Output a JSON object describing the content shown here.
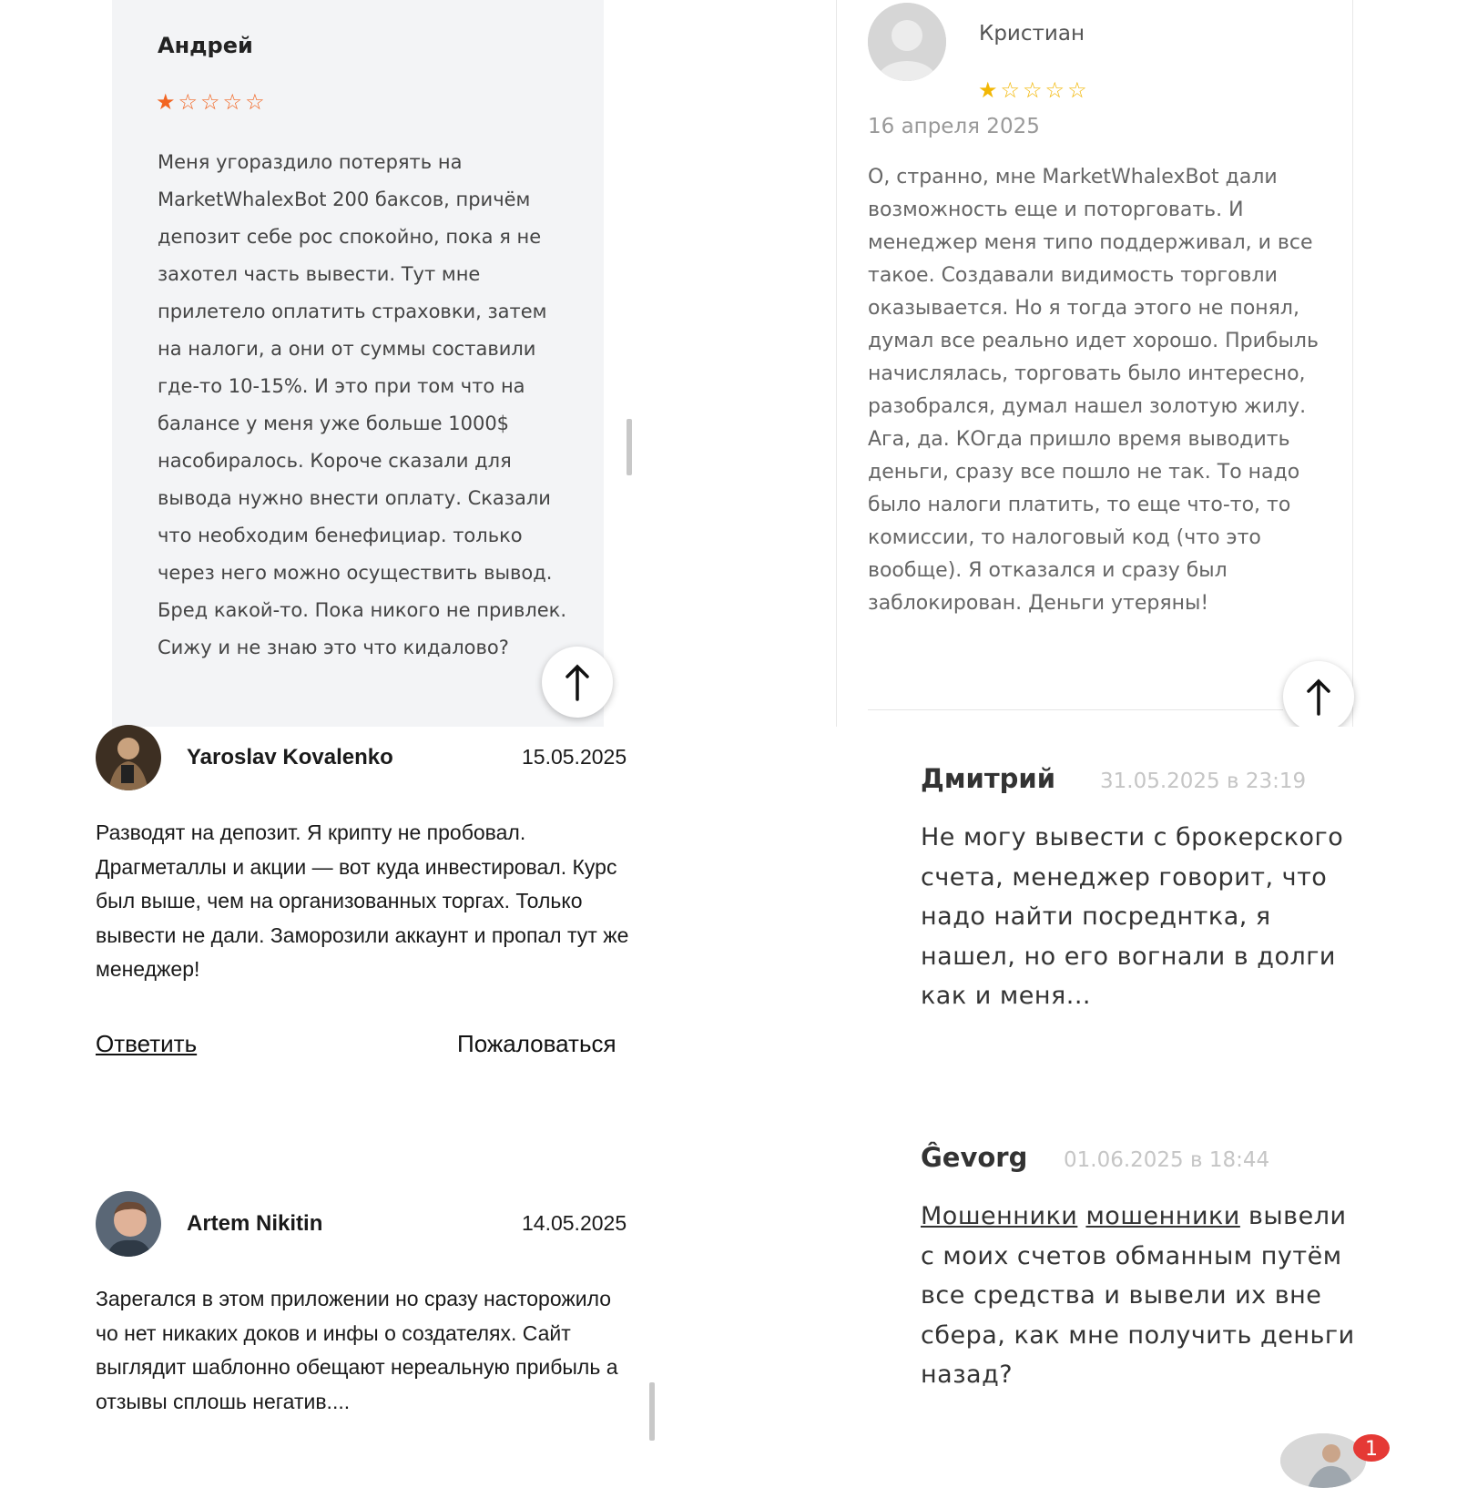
{
  "review_andrey": {
    "author": "Андрей",
    "rating": 1,
    "max_rating": 5,
    "text": "Меня угораздило потерять на MarketWhalexBot 200 баксов, причём депозит себе рос спокойно, пока я не захотел часть вывести. Тут мне прилетело оплатить страховки, затем на налоги, а они от суммы составили где-то 10-15%. И это при том что на балансе у меня уже больше 1000$ насобиралось. Короче сказали для вывода нужно внести оплату. Сказали что необходим бенефициар. только через него можно осуществить вывод. Бред какой-то. Пока никого не привлек. Сижу и не знаю это что кидалово?",
    "star_color": "#f26522"
  },
  "review_kristian": {
    "author": "Кристиан",
    "rating": 1,
    "max_rating": 5,
    "date": "16 апреля 2025",
    "text": "О, странно, мне MarketWhalexBot дали возможность еще и поторговать. И менеджер меня типо поддерживал, и все такое. Создавали видимость торговли оказывается. Но я тогда этого не понял, думал все реально идет хорошо. Прибыль начислялась, торговать было интересно, разобрался, думал нашел золотую жилу. Ага, да. КОгда пришло время выводить деньги, сразу все пошло не так. То надо было налоги платить, то еще что-то, то комиссии, то налоговый код (что это вообще). Я отказался и сразу был заблокирован. Деньги утеряны!",
    "star_color": "#f2b705"
  },
  "comments_left": [
    {
      "author": "Yaroslav Kovalenko",
      "date": "15.05.2025",
      "text": "Разводят на депозит. Я крипту не пробовал. Драгметаллы и акции — вот куда инвестировал. Курс был выше, чем на организованных торгах. Только вывести не дали. Заморозили аккаунт и пропал тут же менеджер!",
      "reply_label": "Ответить",
      "report_label": "Пожаловаться"
    },
    {
      "author": "Artem Nikitin",
      "date": "14.05.2025",
      "text": "Зарегался в этом приложении но сразу насторожило чо нет никаких доков и инфы о создателях. Сайт выглядит шаблонно обещают нереальную прибыль а отзывы сплошь негатив...."
    }
  ],
  "comments_right": [
    {
      "author": "Дмитрий",
      "date": "31.05.2025 в 23:19",
      "text": "Не могу вывести с брокерского счета, менеджер говорит, что надо найти посреднтка, я нашел, но его вогнали в долги как и меня..."
    },
    {
      "author": "Ĝevorg",
      "date": "01.06.2025 в 18:44",
      "link_1": "Мошенники",
      "link_2": "мошенники",
      "text": "вывели с моих счетов обманным путём все средства и вывели их вне сбера, как мне получить деньги назад?"
    }
  ],
  "chat_widget": {
    "badge_count": "1"
  },
  "icons": {
    "scroll_top": "arrow-up-icon",
    "avatar_placeholder": "user-placeholder-icon"
  }
}
